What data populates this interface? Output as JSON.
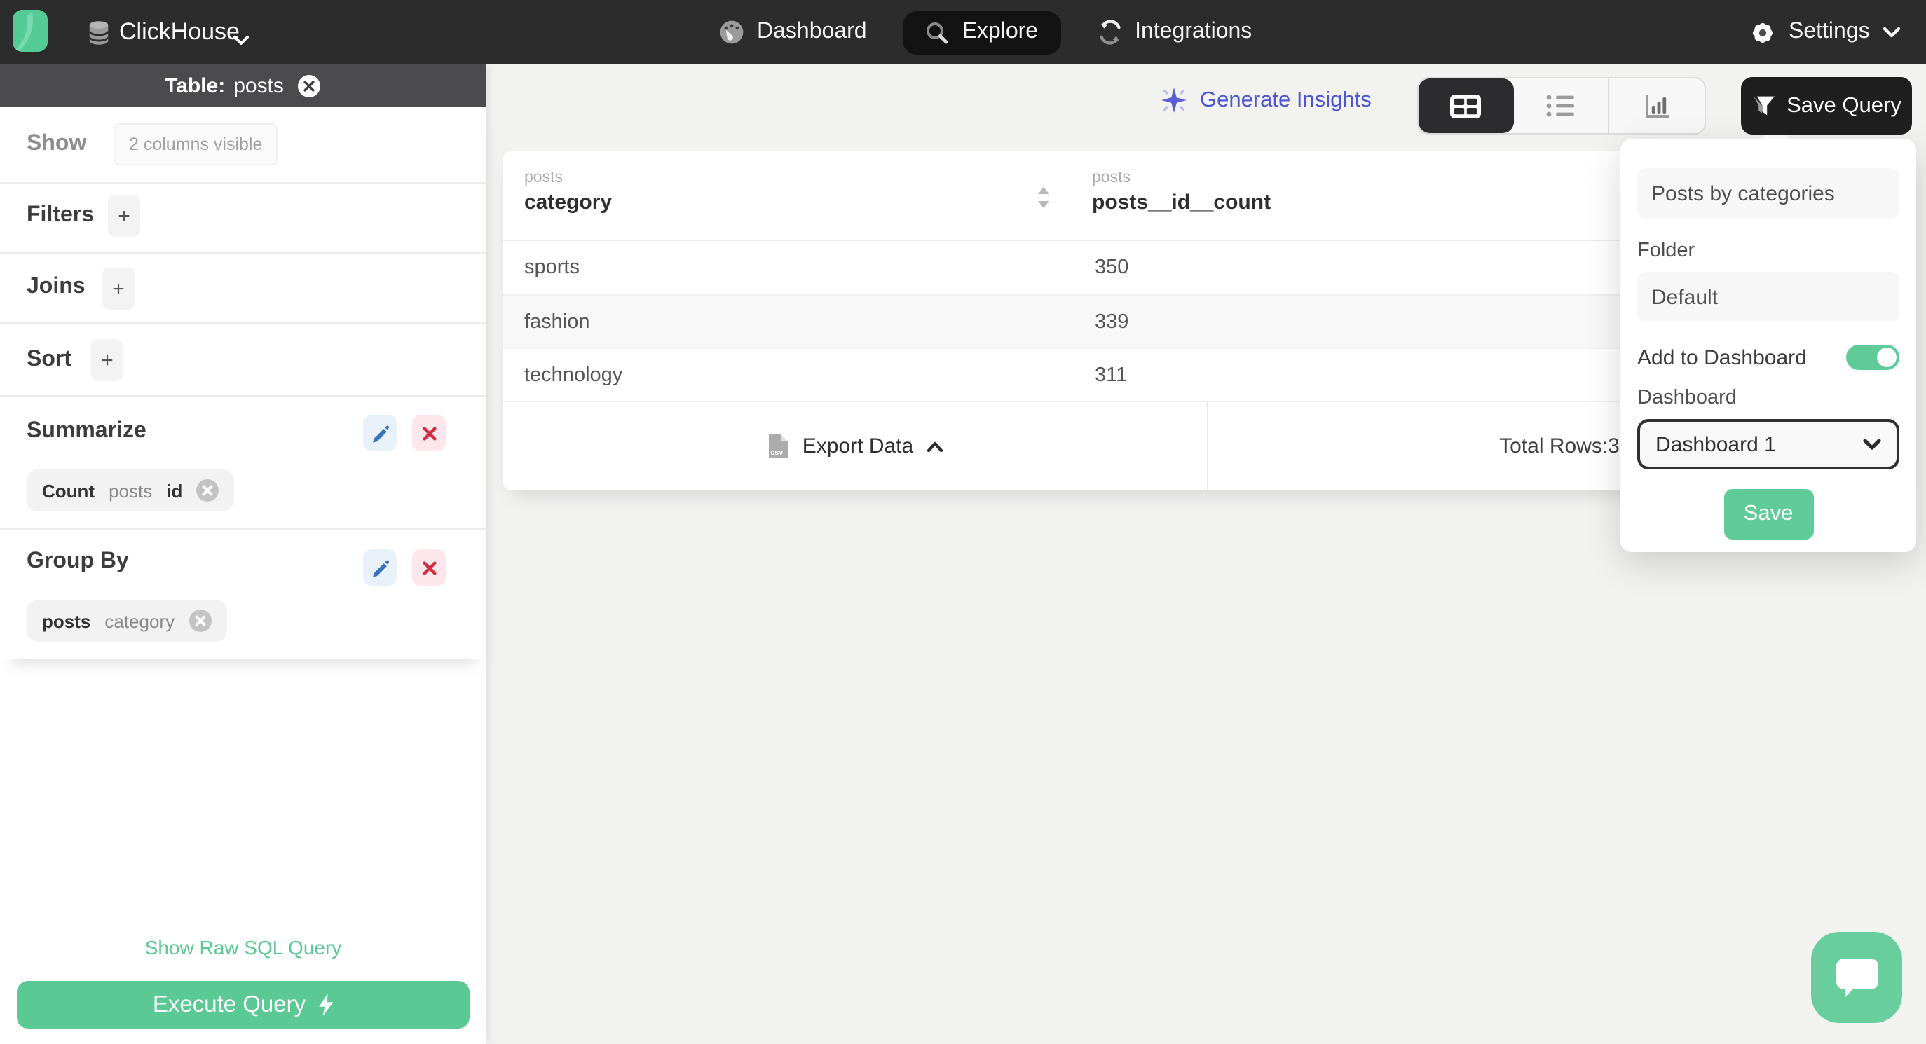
{
  "nav": {
    "brand": "ClickHouse",
    "tabs": [
      {
        "label": "Dashboard"
      },
      {
        "label": "Explore"
      },
      {
        "label": "Integrations"
      }
    ],
    "settings_label": "Settings"
  },
  "sidebar": {
    "table_label": "Table:",
    "table_name": "posts",
    "show_label": "Show",
    "columns_visible": "2 columns visible",
    "filters_label": "Filters",
    "joins_label": "Joins",
    "sort_label": "Sort",
    "add_label": "+",
    "summarize_label": "Summarize",
    "summarize_chip": {
      "agg": "Count",
      "table": "posts",
      "column": "id"
    },
    "group_by_label": "Group By",
    "group_chip": {
      "table": "posts",
      "column": "category"
    },
    "raw_sql_link": "Show Raw SQL Query",
    "execute_button": "Execute Query"
  },
  "main": {
    "generate_insights": "Generate Insights",
    "save_query_button": "Save Query",
    "table": {
      "col1_table": "posts",
      "col1_name": "category",
      "col2_table": "posts",
      "col2_name": "posts__id__count",
      "rows": [
        {
          "category": "sports",
          "count": "350"
        },
        {
          "category": "fashion",
          "count": "339"
        },
        {
          "category": "technology",
          "count": "311"
        }
      ],
      "export_label": "Export Data",
      "total_rows": "Total Rows:3"
    }
  },
  "popover": {
    "query_name": "Posts by categories",
    "folder_label": "Folder",
    "folder_value": "Default",
    "add_to_dashboard_label": "Add to Dashboard",
    "dashboard_label": "Dashboard",
    "dashboard_value": "Dashboard 1",
    "save_button": "Save"
  },
  "icons": [
    "clickhouse-logo",
    "database-icon",
    "chevron-down-icon",
    "gauge-icon",
    "search-icon",
    "sync-icon",
    "gear-icon",
    "close-circle-icon",
    "edit-pencil-icon",
    "delete-x-icon",
    "chip-remove-icon",
    "sparkle-icon",
    "table-view-icon",
    "list-view-icon",
    "chart-view-icon",
    "funnel-icon",
    "sort-arrows-icon",
    "csv-file-icon",
    "chevron-up-icon",
    "lightning-icon",
    "chat-bubble-icon"
  ],
  "colors": {
    "topnav_bg": "#2c2c2d",
    "accent_green": "#5bc993",
    "insight_blue": "#5056cf",
    "edit_blue": "#3a72b8",
    "delete_red": "#cf2f44",
    "table_bar_bg": "#4b4b4d",
    "main_bg": "#f2f2f1"
  }
}
